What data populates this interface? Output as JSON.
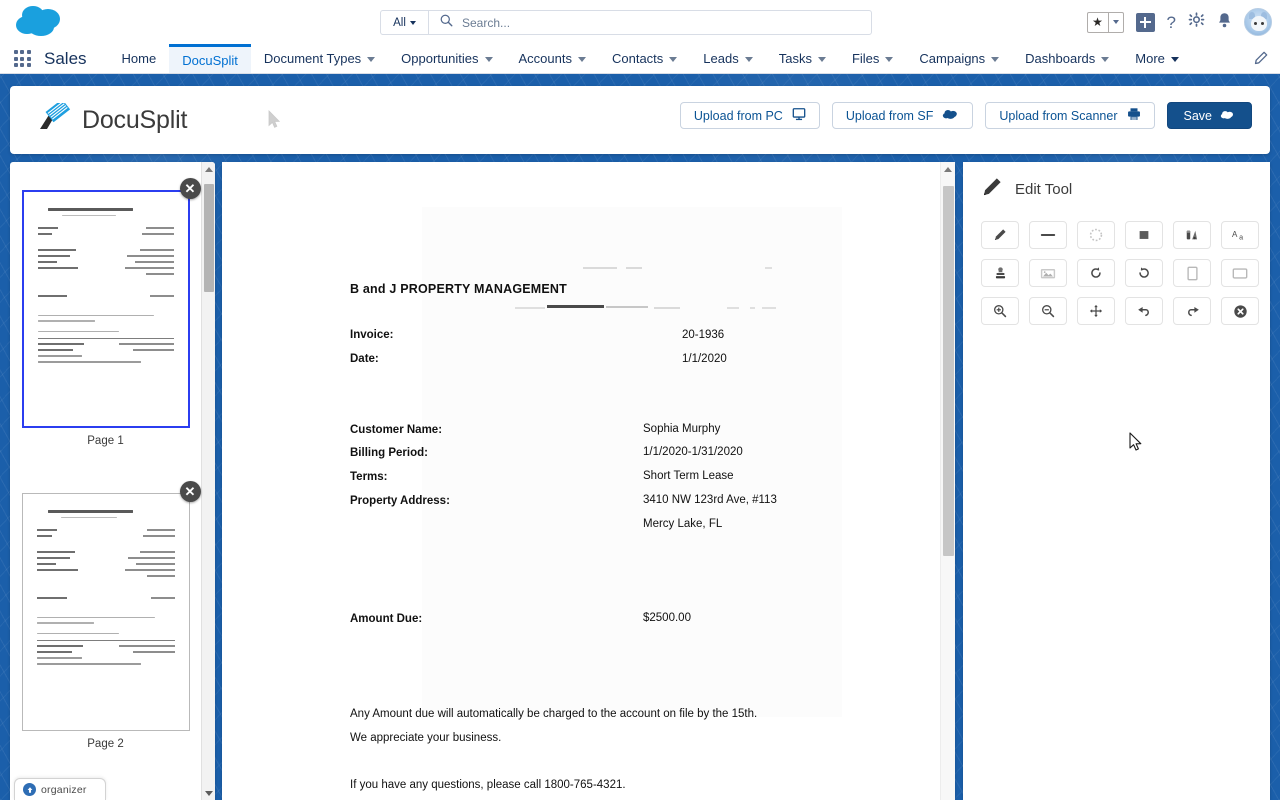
{
  "global_header": {
    "logo": "salesforce-cloud-logo",
    "search": {
      "scope": "All",
      "placeholder": "Search...",
      "value": ""
    },
    "icons": [
      "favorites-star-icon",
      "favorites-caret-icon",
      "add-icon",
      "help-icon",
      "setup-gear-icon",
      "notifications-bell-icon",
      "user-avatar"
    ]
  },
  "nav": {
    "app_launcher": "app-launcher-waffle",
    "app_name": "Sales",
    "items": [
      {
        "label": "Home",
        "has_caret": false,
        "active": false
      },
      {
        "label": "DocuSplit",
        "has_caret": false,
        "active": true
      },
      {
        "label": "Document Types",
        "has_caret": true,
        "active": false
      },
      {
        "label": "Opportunities",
        "has_caret": true,
        "active": false
      },
      {
        "label": "Accounts",
        "has_caret": true,
        "active": false
      },
      {
        "label": "Contacts",
        "has_caret": true,
        "active": false
      },
      {
        "label": "Leads",
        "has_caret": true,
        "active": false
      },
      {
        "label": "Tasks",
        "has_caret": true,
        "active": false
      },
      {
        "label": "Files",
        "has_caret": true,
        "active": false
      },
      {
        "label": "Campaigns",
        "has_caret": true,
        "active": false
      },
      {
        "label": "Dashboards",
        "has_caret": true,
        "active": false
      },
      {
        "label": "More",
        "has_caret": true,
        "active": false
      }
    ],
    "edit_pencil": "edit-nav-pencil-icon"
  },
  "app": {
    "brand": "DocuSplit",
    "buttons": [
      {
        "label": "Upload from PC",
        "icon": "monitor-icon",
        "style": "outline"
      },
      {
        "label": "Upload from SF",
        "icon": "cloud-icon",
        "style": "outline"
      },
      {
        "label": "Upload from Scanner",
        "icon": "printer-icon",
        "style": "outline"
      },
      {
        "label": "Save",
        "icon": "cloud-upload-icon",
        "style": "primary"
      }
    ]
  },
  "thumbnails": {
    "pages": [
      {
        "label": "Page 1",
        "selected": true,
        "close": "✕"
      },
      {
        "label": "Page 2",
        "selected": false,
        "close": "✕"
      }
    ],
    "scroll_up": "scroll-up-arrow",
    "scroll_down": "scroll-down-arrow"
  },
  "document": {
    "company": "B and J PROPERTY MANAGEMENT",
    "fields": [
      {
        "label": "Invoice:",
        "value": "20-1936"
      },
      {
        "label": "Date:",
        "value": "1/1/2020"
      }
    ],
    "details": [
      {
        "label": "Customer Name:",
        "value": "Sophia Murphy"
      },
      {
        "label": "Billing Period:",
        "value": "1/1/2020-1/31/2020"
      },
      {
        "label": "Terms:",
        "value": "Short Term Lease"
      },
      {
        "label": "Property Address:",
        "value": "3410 NW 123rd Ave, #113"
      },
      {
        "label": "",
        "value": "Mercy Lake, FL"
      }
    ],
    "amount": {
      "label": "Amount Due:",
      "value": "$2500.00"
    },
    "notes": [
      "Any Amount due will automatically be charged to the account on file by the 15th.",
      "We appreciate your business.",
      "If you have any questions, please call 1800-765-4321."
    ]
  },
  "edit_tool": {
    "title": "Edit Tool",
    "title_icon": "pencil-icon",
    "tools": [
      {
        "name": "pen-icon"
      },
      {
        "name": "line-icon"
      },
      {
        "name": "marquee-select-icon"
      },
      {
        "name": "filled-square-icon"
      },
      {
        "name": "color-palette-icon"
      },
      {
        "name": "text-font-icon"
      },
      {
        "name": "stamp-icon"
      },
      {
        "name": "image-icon"
      },
      {
        "name": "rotate-left-icon"
      },
      {
        "name": "rotate-right-icon"
      },
      {
        "name": "portrait-page-icon"
      },
      {
        "name": "landscape-page-icon"
      },
      {
        "name": "zoom-in-icon"
      },
      {
        "name": "zoom-out-icon"
      },
      {
        "name": "move-icon"
      },
      {
        "name": "undo-icon"
      },
      {
        "name": "redo-icon"
      },
      {
        "name": "clear-cancel-icon"
      }
    ]
  },
  "organizer_badge": {
    "label": "organizer",
    "icon": "upload-circle-icon"
  },
  "colors": {
    "brand_blue": "#1b5faa",
    "primary_button": "#14508c",
    "link_blue": "#0070d2",
    "selected_thumb": "#2b3df0",
    "nav_text": "#16325c"
  }
}
